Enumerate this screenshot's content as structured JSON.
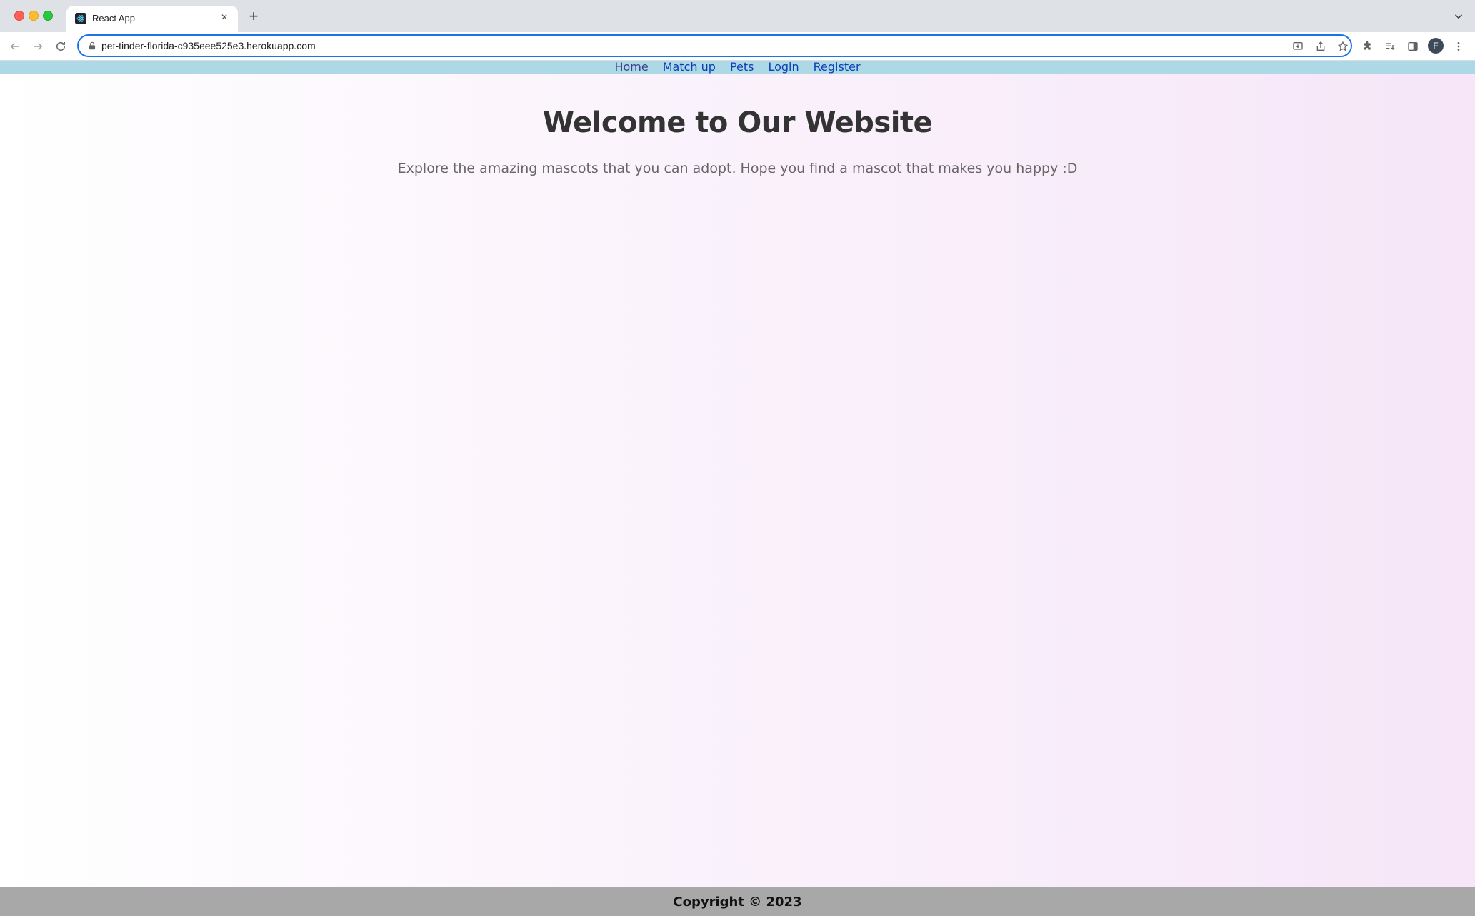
{
  "browser": {
    "tab": {
      "title": "React App",
      "favicon": "react-logo-icon"
    },
    "url": "pet-tinder-florida-c935eee525e3.herokuapp.com",
    "avatar_initial": "F"
  },
  "site": {
    "nav": [
      {
        "label": "Home"
      },
      {
        "label": "Match up"
      },
      {
        "label": "Pets"
      },
      {
        "label": "Login"
      },
      {
        "label": "Register"
      }
    ],
    "hero": {
      "title": "Welcome to Our Website",
      "subtitle": "Explore the amazing mascots that you can adopt. Hope you find a mascot that makes you happy :D"
    },
    "footer": "Copyright © 2023"
  },
  "colors": {
    "nav_bar": "#add8e6",
    "link": "#0a3fb8",
    "footer": "#a8a8a8",
    "omnibox_focus": "#1a73e8"
  }
}
